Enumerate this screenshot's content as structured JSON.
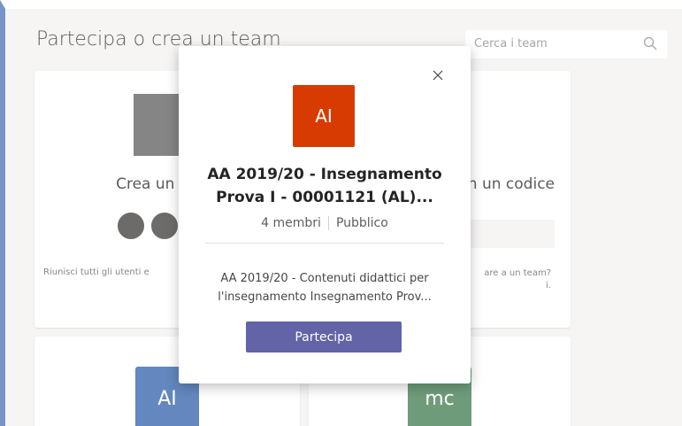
{
  "page": {
    "title": "Partecipa o crea un team",
    "search_placeholder": "Cerca i team"
  },
  "cards": {
    "create": {
      "title": "Crea un team",
      "description": "Riunisci tutti gli utenti e"
    },
    "code": {
      "title": "team con un codice",
      "description_line1": "are a un team?",
      "description_line2": "i."
    },
    "teams": [
      {
        "initials": "AI",
        "color": "#2f5fa8"
      },
      {
        "initials": "mc",
        "color": "#3e7b4f"
      }
    ]
  },
  "modal": {
    "avatar_initials": "AI",
    "avatar_color": "#d83b01",
    "title_line1": "AA 2019/20 - Insegnamento",
    "title_line2": "Prova I - 00001121 (AL)...",
    "members": "4 membri",
    "visibility": "Pubblico",
    "description_line1": "AA 2019/20 - Contenuti didattici per",
    "description_line2": "l'insegnamento Insegnamento Prov...",
    "join_label": "Partecipa",
    "button_color": "#6264a7"
  }
}
